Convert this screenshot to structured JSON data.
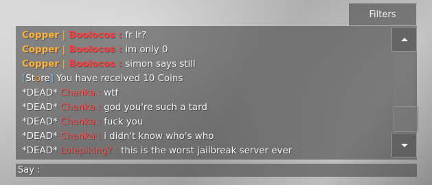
{
  "filters_label": "Filters",
  "chat": [
    {
      "tag": "Copper | ",
      "name": "Boolocos",
      "sep": " : ",
      "msg": "fr lr?"
    },
    {
      "tag": "Copper | ",
      "name": "Boolocos",
      "sep": " : ",
      "msg": "im only 0"
    },
    {
      "tag": "Copper | ",
      "name": "Boolocos",
      "sep": " : ",
      "msg": "simon says still"
    },
    {
      "store_open": "[",
      "store_s": "St",
      "store_o": "o",
      "store_re": "re",
      "store_close": "]",
      "msg": " You have received 10 Coins"
    },
    {
      "prefix": "*DEAD* ",
      "name": "Chanka",
      "sep": " : ",
      "msg": "wtf"
    },
    {
      "prefix": "*DEAD* ",
      "name": "Chanka",
      "sep": " : ",
      "msg": "god you're such a tard"
    },
    {
      "prefix": "*DEAD* ",
      "name": "Chanka",
      "sep": " : ",
      "msg": "fuck you"
    },
    {
      "prefix": "*DEAD* ",
      "name": "Chanka",
      "sep": " : ",
      "msg": "i didn't know who's who"
    },
    {
      "prefix": "*DEAD* ",
      "name": "Lolepiking?",
      "sep": " : ",
      "msg": "this is the worst jailbreak server ever"
    }
  ],
  "say_label": "Say :",
  "say_value": "",
  "colors": {
    "copper_tag": "#ffb23a",
    "player_name": "#ff3b3b",
    "store_bracket": "#6ec6ff",
    "store_o": "#ff9f2a",
    "text": "#f0f0f0"
  },
  "icons": {
    "scroll_up": "triangle-up-icon",
    "scroll_down": "triangle-down-icon"
  }
}
